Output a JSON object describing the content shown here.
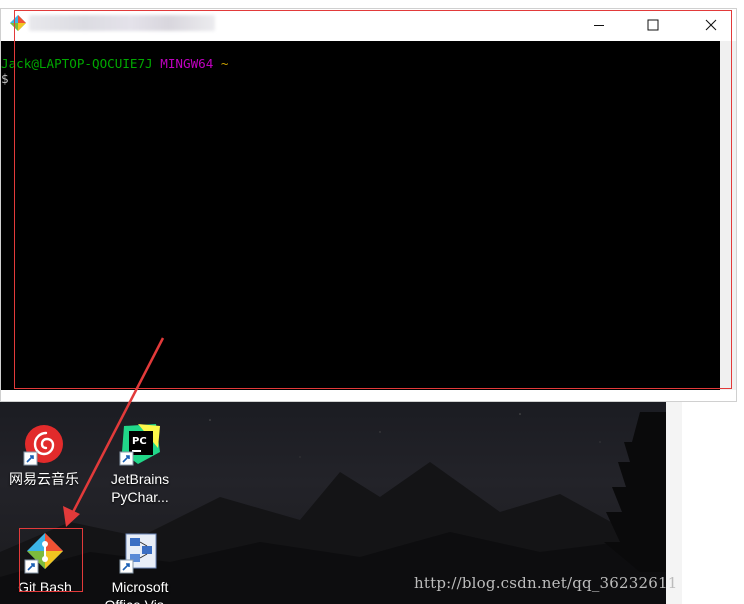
{
  "window": {
    "title": "",
    "controls": {
      "minimize": "minimize",
      "maximize": "maximize",
      "close": "close"
    }
  },
  "terminal": {
    "user_host": "Jack@LAPTOP-QOCUIE7J",
    "system": "MINGW64",
    "path": "~",
    "prompt_symbol": "$"
  },
  "desktop": {
    "icons": [
      {
        "label": "网易云音乐",
        "icon": "netease-music-icon"
      },
      {
        "label_line1": "JetBrains",
        "label_line2": "PyChar...",
        "icon": "pycharm-icon"
      },
      {
        "label": "Git Bash",
        "icon": "git-bash-icon"
      },
      {
        "label_line1": "Microsoft",
        "label_line2": "Office Vis...",
        "icon": "office-visio-icon"
      }
    ]
  },
  "watermark": "http://blog.csdn.net/qq_36232611",
  "colors": {
    "terminal_bg": "#000000",
    "host_green": "#00a800",
    "system_magenta": "#c000c0",
    "path_yellow": "#c8a000",
    "highlight_red": "#e23a3a",
    "music_red": "#e22b2b"
  }
}
